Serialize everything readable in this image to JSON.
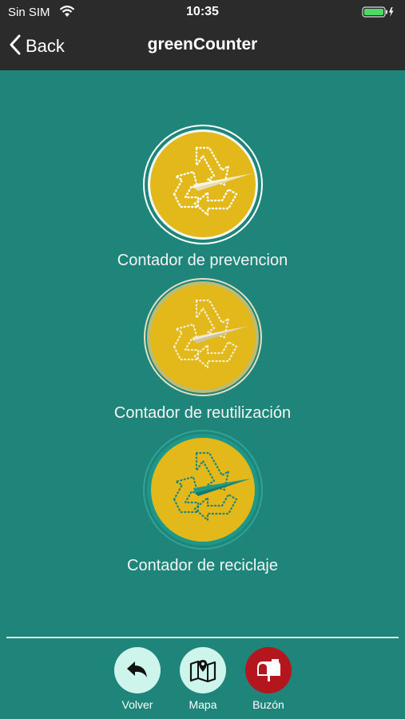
{
  "status_bar": {
    "carrier": "Sin SIM",
    "time": "10:35"
  },
  "nav": {
    "back_label": "Back",
    "title": "greenCounter"
  },
  "counters": [
    {
      "label": "Contador de prevencion"
    },
    {
      "label": "Contador de reutilización"
    },
    {
      "label": "Contador de reciclaje"
    }
  ],
  "tabs": [
    {
      "label": "Volver",
      "icon": "undo-arrow-icon"
    },
    {
      "label": "Mapa",
      "icon": "map-icon"
    },
    {
      "label": "Buzón",
      "icon": "mailbox-icon"
    }
  ],
  "colors": {
    "background": "#1f857a",
    "topbar": "#2b2b2b",
    "gauge_yellow": "#e2b81a",
    "tab_circle": "#cdf5ec",
    "mailbox_red": "#b3161c"
  }
}
